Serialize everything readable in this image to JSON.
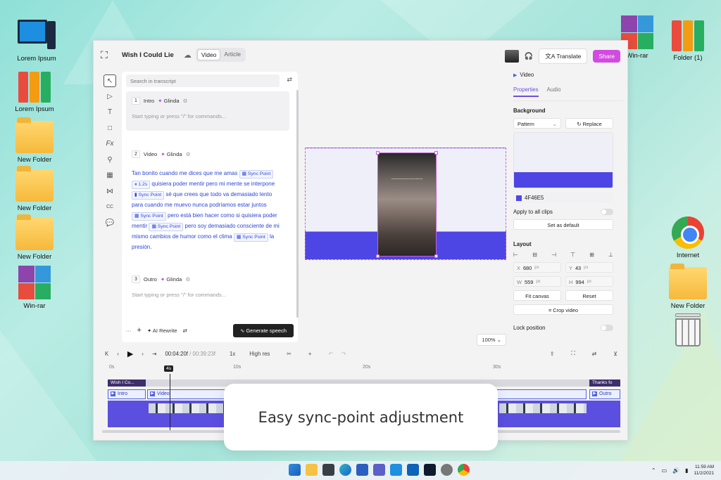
{
  "desktop": {
    "left_icons": [
      {
        "label": "Lorem Ipsum",
        "kind": "computer-icon"
      },
      {
        "label": "Lorem Ipsum",
        "kind": "binders-icon"
      },
      {
        "label": "New Folder",
        "kind": "folder-icon"
      },
      {
        "label": "New Folder",
        "kind": "folder-icon"
      },
      {
        "label": "New Folder",
        "kind": "folder-icon"
      },
      {
        "label": "Win-rar",
        "kind": "winrar-icon"
      }
    ],
    "right_icons": [
      {
        "label": "Win-rar",
        "kind": "winrar-icon"
      },
      {
        "label": "Folder (1)",
        "kind": "binders-icon"
      },
      {
        "label": "Internet",
        "kind": "chrome-icon"
      },
      {
        "label": "New Folder",
        "kind": "folder-icon"
      },
      {
        "label": "",
        "kind": "trash-icon"
      }
    ]
  },
  "app": {
    "title": "Wish I Could Lie",
    "mode_tabs": [
      "Video",
      "Article"
    ],
    "translate_label": "Translate",
    "share_label": "Share"
  },
  "script": {
    "search_placeholder": "Search in transcript",
    "blocks": [
      {
        "num": "1",
        "section": "Intro",
        "voice": "Glinda",
        "placeholder": "Start typing or press \"/\" for commands..."
      },
      {
        "num": "2",
        "section": "Video",
        "voice": "Glinda"
      },
      {
        "num": "3",
        "section": "Outro",
        "voice": "Glinda",
        "placeholder": "Start typing or press \"/\" for commands..."
      }
    ],
    "text_parts": {
      "t1": "Tan bonito cuando me dices que me amas",
      "sp": "Sync Point",
      "pause": "1.2s",
      "t2": "quisiera poder mentir pero mi mente se interpone",
      "t3": "sé que crees que todo va demasiado lento para cuando me muevo nunca podríamos estar juntos",
      "t4": "pero está bien hacer como si quisiera poder mentir",
      "t5": "pero soy demasiado consciente de mi mismo cambios de humor como el clima",
      "t6": "la presión."
    },
    "footer": {
      "more": "···",
      "add": "+",
      "rewrite": "AI Rewrite",
      "generate": "Generate speech"
    }
  },
  "canvas": {
    "zoom": "100%"
  },
  "properties": {
    "header": "Video",
    "tabs": [
      "Properties",
      "Audio"
    ],
    "background_title": "Background",
    "bg_type": "Pattern",
    "replace_label": "Replace",
    "hex": "4F46E5",
    "apply_all": "Apply to all clips",
    "set_default": "Set as default",
    "layout_title": "Layout",
    "x": "680",
    "y": "43",
    "w": "559",
    "h": "994",
    "unit": "px",
    "fit_canvas": "Fit canvas",
    "reset": "Reset",
    "crop": "Crop video",
    "lock": "Lock position"
  },
  "timeline": {
    "current": "00:04:20f",
    "total": "00:39:23f",
    "speed": "1x",
    "res": "High res",
    "ticks": [
      "0s",
      "10s",
      "20s",
      "30s"
    ],
    "playhead": "4s",
    "title_clips": [
      "Wish I Co...",
      "Thanks fo"
    ],
    "sections": [
      "Intro",
      "Video",
      "Outro"
    ]
  },
  "overlay": {
    "caption": "Easy sync-point adjustment"
  },
  "taskbar": {
    "time": "11:59 AM",
    "date": "11/2/2021"
  },
  "colors": {
    "accent": "#4F46E5",
    "share": "#D24BE0",
    "script_text": "#2B46D8"
  }
}
